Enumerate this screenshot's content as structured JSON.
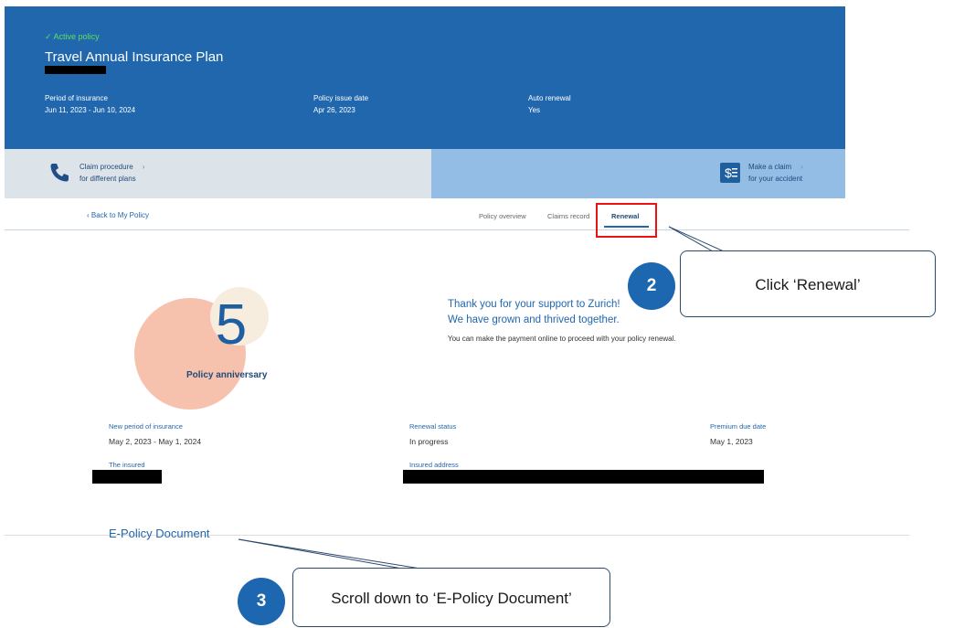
{
  "header": {
    "status": "✓ Active policy",
    "title": "Travel Annual Insurance Plan",
    "fields": [
      {
        "label": "Period of insurance",
        "value": "Jun 11, 2023 - Jun 10, 2024"
      },
      {
        "label": "Policy issue date",
        "value": "Apr 26, 2023"
      },
      {
        "label": "Auto renewal",
        "value": "Yes"
      }
    ]
  },
  "actions": {
    "claim_procedure": {
      "title": "Claim procedure",
      "subtitle": "for different plans",
      "icon": "phone-icon"
    },
    "make_claim": {
      "title": "Make a claim",
      "subtitle": "for your accident",
      "icon": "claim-document-icon"
    }
  },
  "nav": {
    "back": "Back to My Policy",
    "tabs": [
      "Policy overview",
      "Claims record",
      "Renewal"
    ],
    "active_tab": "Renewal"
  },
  "anniversary": {
    "number": "5",
    "label": "Policy anniversary"
  },
  "message": {
    "line1": "Thank you for your support to Zurich!",
    "line2": "We have grown and thrived together.",
    "sub": "You can make the payment online to proceed with your policy renewal."
  },
  "details": {
    "new_period": {
      "label": "New period of insurance",
      "value": "May 2, 2023 - May 1, 2024"
    },
    "renewal_status": {
      "label": "Renewal status",
      "value": "In progress"
    },
    "premium_due": {
      "label": "Premium due date",
      "value": "May 1, 2023"
    },
    "insured": {
      "label": "The insured"
    },
    "address": {
      "label": "Insured address"
    }
  },
  "epolicy": {
    "title": "E-Policy Document"
  },
  "callouts": [
    {
      "step": "2",
      "text": "Click ‘Renewal’"
    },
    {
      "step": "3",
      "text": "Scroll down to ‘E-Policy Document’"
    }
  ],
  "colors": {
    "header_blue": "#2167ae",
    "highlight_red": "#ee1111",
    "active_green": "#5ce05c"
  }
}
